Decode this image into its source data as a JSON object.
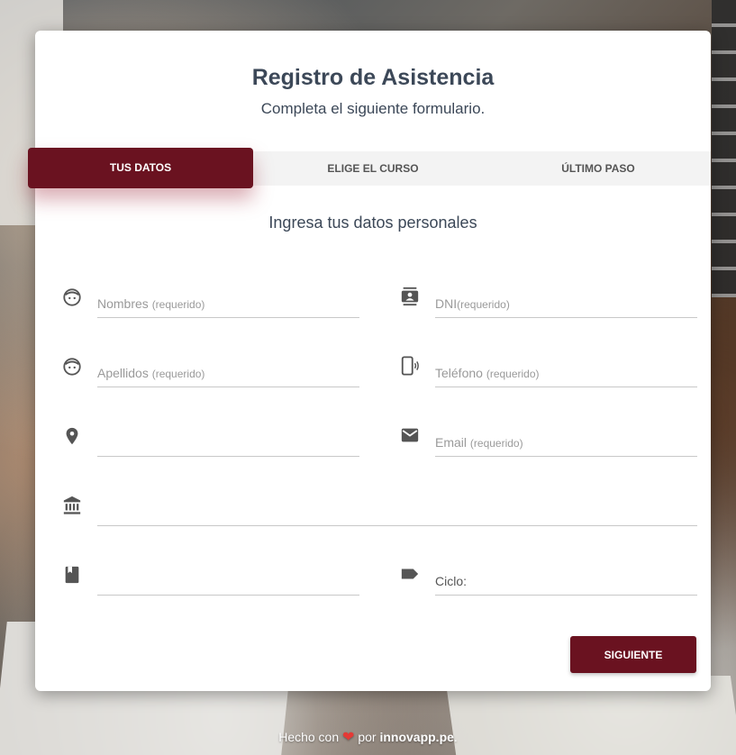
{
  "header": {
    "title": "Registro de Asistencia",
    "subtitle": "Completa el siguiente formulario."
  },
  "tabs": [
    {
      "label": "TUS DATOS",
      "active": true
    },
    {
      "label": "ELIGE EL CURSO",
      "active": false
    },
    {
      "label": "ÚLTIMO PASO",
      "active": false
    }
  ],
  "section": {
    "title": "Ingresa tus datos personales"
  },
  "fields": {
    "nombres": {
      "label": "Nombres",
      "hint": "(requerido)",
      "icon": "face-icon"
    },
    "dni": {
      "label": "DNI",
      "hint": "(requerido)",
      "icon": "contact-icon"
    },
    "apellidos": {
      "label": "Apellidos",
      "hint": "(requerido)",
      "icon": "face-icon"
    },
    "telefono": {
      "label": "Teléfono",
      "hint": "(requerido)",
      "icon": "phone-icon"
    },
    "direccion": {
      "label": "",
      "icon": "location-pin-icon"
    },
    "email": {
      "label": "Email",
      "hint": "(requerido)",
      "icon": "mail-icon"
    },
    "institucion": {
      "label": "",
      "icon": "bank-icon"
    },
    "carrera": {
      "label": "",
      "icon": "book-icon"
    },
    "ciclo": {
      "label": "Ciclo:",
      "icon": "label-icon"
    }
  },
  "actions": {
    "next_label": "SIGUIENTE"
  },
  "footer": {
    "prefix": "Hecho con",
    "middle": "por",
    "brand": "innovapp.pe",
    "suffix": "."
  },
  "colors": {
    "accent": "#6a1220",
    "title": "#3c4858"
  }
}
